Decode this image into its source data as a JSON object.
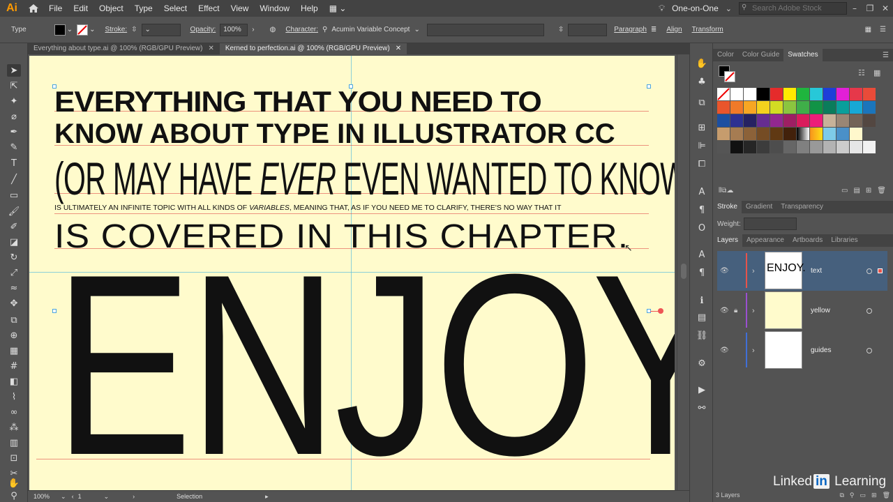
{
  "app": {
    "logo": "Ai",
    "menus": [
      "File",
      "Edit",
      "Object",
      "Type",
      "Select",
      "Effect",
      "View",
      "Window",
      "Help"
    ],
    "workspace": "One-on-One",
    "search_placeholder": "Search Adobe Stock"
  },
  "control": {
    "tool_label": "Type",
    "stroke_label": "Stroke:",
    "opacity_label": "Opacity:",
    "opacity_value": "100%",
    "character_label": "Character:",
    "font_name": "Acumin Variable Concept",
    "paragraph_label": "Paragraph",
    "align_label": "Align",
    "transform_label": "Transform"
  },
  "tabs": [
    {
      "label": "Everything about type.ai @ 100% (RGB/GPU Preview)",
      "active": false
    },
    {
      "label": "Kerned to perfection.ai @ 100% (RGB/GPU Preview)",
      "active": true
    }
  ],
  "artboard": {
    "line1": "EVERYTHING THAT YOU NEED TO",
    "line2": "KNOW ABOUT TYPE IN ILLUSTRATOR CC",
    "line3a": "(OR MAY HAVE ",
    "line3b": "EVER",
    "line3c": " EVEN WANTED",
    "line3d": " TO KNOW)",
    "line4a": "IS ULTIMATELY AN INFINITE TOPIC WITH ALL KINDS OF ",
    "line4b": "VARIABLES",
    "line4c": ", MEANING THAT, AS IF YOU NEED ME TO CLARIFY, THERE'S NO WAY THAT IT",
    "line5": "IS COVERED IN THIS CHAPTER.",
    "line6": "ENJOY."
  },
  "status": {
    "zoom": "100%",
    "artboard_num": "1",
    "tool_status": "Selection"
  },
  "color_panel": {
    "tabs": [
      "Color",
      "Color Guide",
      "Swatches"
    ],
    "active_tab": "Swatches"
  },
  "stroke_panel": {
    "tabs": [
      "Stroke",
      "Gradient",
      "Transparency"
    ],
    "weight_label": "Weight:"
  },
  "layers_panel": {
    "tabs": [
      "Layers",
      "Appearance",
      "Artboards",
      "Libraries"
    ],
    "layers": [
      {
        "name": "text",
        "color": "#e8534a",
        "selected": true,
        "locked": false
      },
      {
        "name": "yellow",
        "color": "#9a4fd1",
        "selected": false,
        "locked": true
      },
      {
        "name": "guides",
        "color": "#3f6fd8",
        "selected": false,
        "locked": false
      }
    ],
    "count_label": "3 Layers"
  },
  "branding": {
    "left": "Linked",
    "mid": "in",
    "right": " Learning"
  },
  "colors": {
    "artboard_bg": "#fffbcc",
    "ui_dark": "#434343",
    "ui_panel": "#535353",
    "selection_blue": "#46607d",
    "accent_orange": "#ff9a00"
  }
}
